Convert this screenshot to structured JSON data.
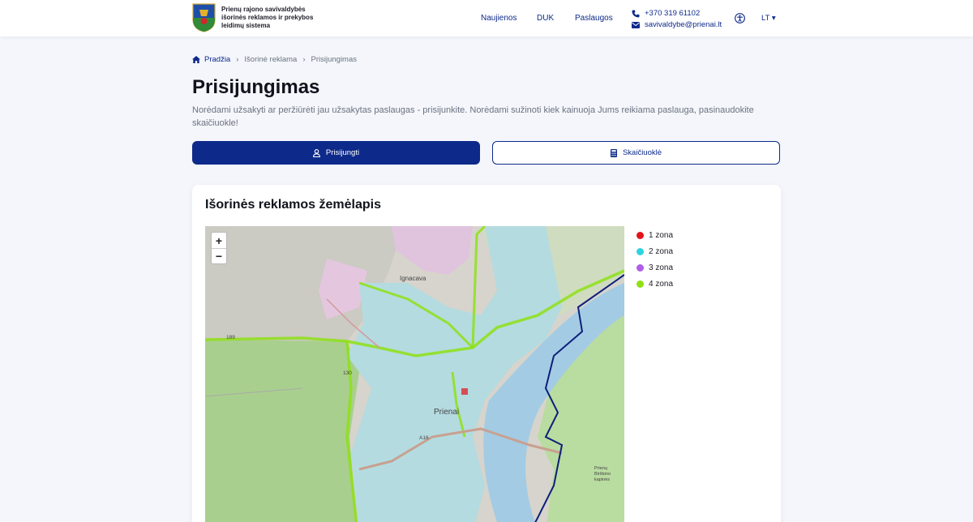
{
  "header": {
    "site_title": "Prienų rajono savivaldybės išorinės reklamos ir prekybos leidimų sistema",
    "nav": [
      "Naujienos",
      "DUK",
      "Paslaugos"
    ],
    "phone": "+370 319 61102",
    "email": "savivaldybe@prienai.lt",
    "lang": "LT ▾"
  },
  "breadcrumb": [
    "Pradžia",
    "Išorinė reklama",
    "Prisijungimas"
  ],
  "page": {
    "title": "Prisijungimas",
    "intro": "Norėdami užsakyti ar peržiūrėti jau užsakytas paslaugas - prisijunkite. Norėdami sužinoti kiek kainuoja Jums reikiama paslauga, pasinaudokite skaičiuokle!",
    "login_label": "Prisijungti",
    "calculator_label": "Skaičiuoklė"
  },
  "map_card": {
    "title": "Išorinės reklamos žemėlapis",
    "zoom_in": "+",
    "zoom_out": "−",
    "labels": {
      "town": "Prienai",
      "village": "Ignacava",
      "road_a": "A16",
      "road_b": "130",
      "road_c": "189",
      "cemetery": "Prienų Birštono kapinės"
    },
    "legend": [
      {
        "label": "1 zona",
        "color": "#e3131b"
      },
      {
        "label": "2 zona",
        "color": "#2fd3e0"
      },
      {
        "label": "3 zona",
        "color": "#b05ee8"
      },
      {
        "label": "4 zona",
        "color": "#8ee015"
      }
    ]
  }
}
